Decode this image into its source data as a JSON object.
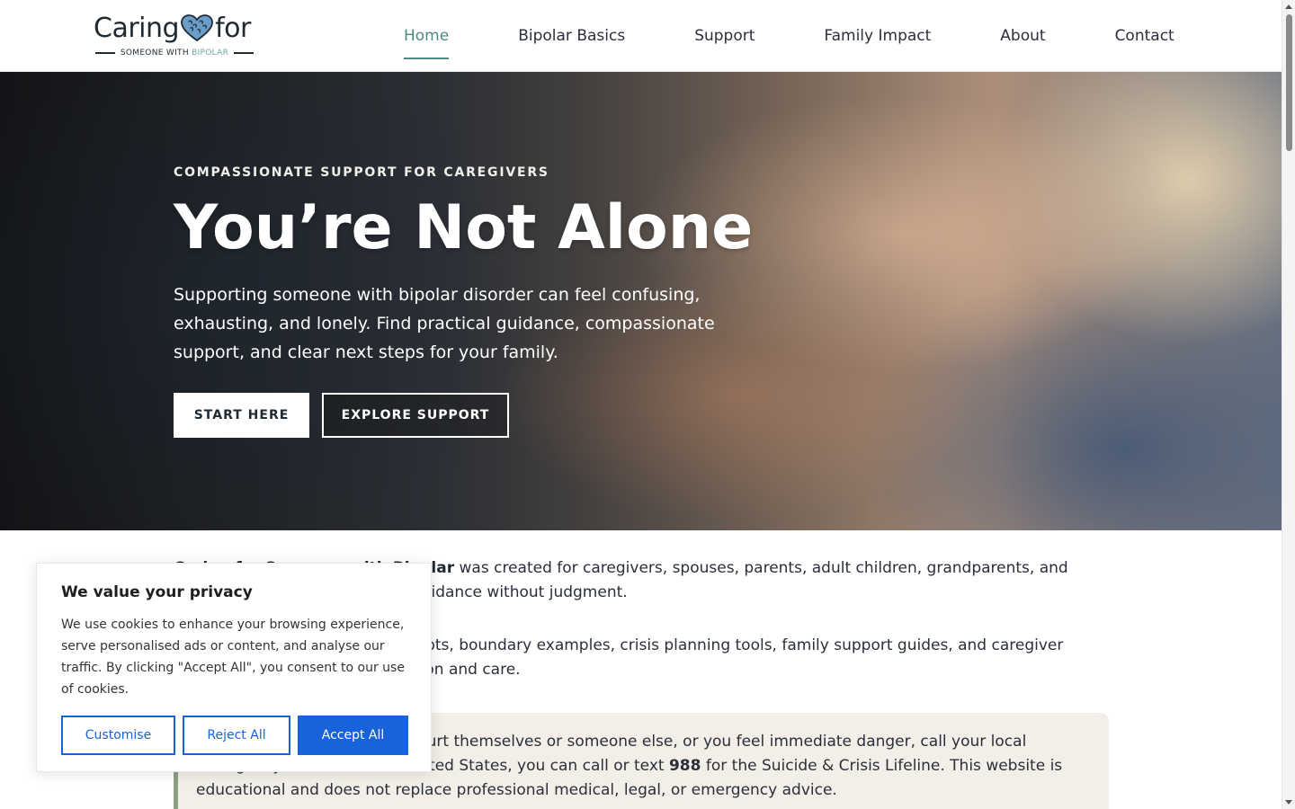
{
  "logo": {
    "main_left": "Caring",
    "main_right": "for",
    "sub_prefix": "SOMEONE WITH ",
    "sub_highlight": "BIPOLAR"
  },
  "nav": {
    "items": [
      {
        "label": "Home",
        "active": true
      },
      {
        "label": "Bipolar Basics",
        "active": false
      },
      {
        "label": "Support",
        "active": false
      },
      {
        "label": "Family Impact",
        "active": false
      },
      {
        "label": "About",
        "active": false
      },
      {
        "label": "Contact",
        "active": false
      }
    ]
  },
  "hero": {
    "eyebrow": "COMPASSIONATE SUPPORT FOR CAREGIVERS",
    "title": "You’re Not Alone",
    "text": "Supporting someone with bipolar disorder can feel confusing, exhausting, and lonely. Find practical guidance, compassionate support, and clear next steps for your family.",
    "start_label": "START HERE",
    "explore_label": "EXPLORE SUPPORT"
  },
  "content": {
    "para1_bold": "Caring for Someone with Bipolar",
    "para1_rest": " was created for caregivers, spouses, parents, adult children, grandparents, and loved ones who need practical guidance without judgment.",
    "para2": "Here you’ll find conversation scripts, boundary examples, crisis planning tools, family support guides, and caregiver resources created with compassion and care.",
    "crisis_pre": "If you believe someone may hurt themselves or someone else, or you feel immediate danger, call your local emergency number. In the United States, you can call or text ",
    "crisis_number": "988",
    "crisis_post": " for the Suicide & Crisis Lifeline. This website is educational and does not replace professional medical, legal, or emergency advice."
  },
  "cookie": {
    "title": "We value your privacy",
    "text": "We use cookies to enhance your browsing experience, serve personalised ads or content, and analyse our traffic. By clicking \"Accept All\", you consent to our use of cookies.",
    "customise_label": "Customise",
    "reject_label": "Reject All",
    "accept_label": "Accept All"
  },
  "colors": {
    "accent": "#4e8a83",
    "cookie_blue": "#1863dc",
    "crisis_bg": "#f3efe8",
    "crisis_border": "#8aa080"
  },
  "icons": {
    "logo_mark": "brain-heart-icon"
  }
}
